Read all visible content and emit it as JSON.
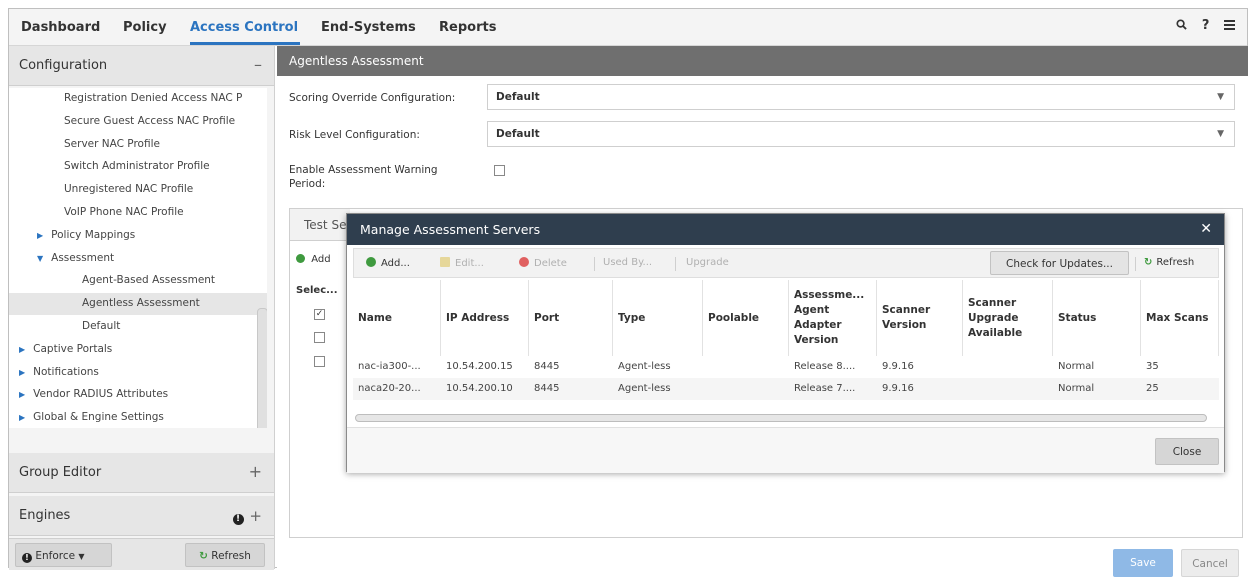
{
  "nav": {
    "items": [
      "Dashboard",
      "Policy",
      "Access Control",
      "End-Systems",
      "Reports"
    ],
    "active": "Access Control",
    "icons": [
      "search-icon",
      "help-icon",
      "menu-icon"
    ],
    "help_glyph": "?"
  },
  "sidebar": {
    "configuration_title": "Configuration",
    "tree": [
      {
        "label": "Registration Denied Access NAC P",
        "level": 2
      },
      {
        "label": "Secure Guest Access NAC Profile",
        "level": 2
      },
      {
        "label": "Server NAC Profile",
        "level": 2
      },
      {
        "label": "Switch Administrator Profile",
        "level": 2
      },
      {
        "label": "Unregistered NAC Profile",
        "level": 2
      },
      {
        "label": "VoIP Phone NAC Profile",
        "level": 2
      },
      {
        "label": "Policy Mappings",
        "level": 1,
        "arrow": "collapsed"
      },
      {
        "label": "Assessment",
        "level": 1,
        "arrow": "expanded"
      },
      {
        "label": "Agent-Based Assessment",
        "level": 3
      },
      {
        "label": "Agentless Assessment",
        "level": 3,
        "selected": true
      },
      {
        "label": "Default",
        "level": 3
      },
      {
        "label": "Captive Portals",
        "level": 0,
        "arrow": "collapsed"
      },
      {
        "label": "Notifications",
        "level": 0,
        "arrow": "collapsed"
      },
      {
        "label": "Vendor RADIUS Attributes",
        "level": 0,
        "arrow": "collapsed"
      },
      {
        "label": "Global & Engine Settings",
        "level": 0,
        "arrow": "collapsed"
      }
    ],
    "group_editor_title": "Group Editor",
    "engines_title": "Engines",
    "enforce_label": "Enforce",
    "refresh_label": "Refresh"
  },
  "main": {
    "title": "Agentless Assessment",
    "scoring_label": "Scoring Override Configuration:",
    "scoring_value": "Default",
    "risk_label": "Risk Level Configuration:",
    "risk_value": "Default",
    "warning_label_line1": "Enable Assessment Warning",
    "warning_label_line2": "Period:",
    "test_tab": "Test Se",
    "add_partial": "Add",
    "select_col": "Selec...",
    "save_label": "Save",
    "cancel_label": "Cancel"
  },
  "modal": {
    "title": "Manage Assessment Servers",
    "toolbar": {
      "add": "Add...",
      "edit": "Edit...",
      "delete": "Delete",
      "used_by": "Used By...",
      "upgrade": "Upgrade",
      "check_updates": "Check for Updates...",
      "refresh": "Refresh"
    },
    "columns": [
      "Name",
      "IP Address",
      "Port",
      "Type",
      "Poolable",
      "Assessme... Agent Adapter Version",
      "Scanner Version",
      "Scanner Upgrade Available",
      "Status",
      "Max Scans"
    ],
    "rows": [
      [
        "nac-ia300-...",
        "10.54.200.15",
        "8445",
        "Agent-less",
        "",
        "Release 8....",
        "9.9.16",
        "",
        "Normal",
        "35"
      ],
      [
        "naca20-20...",
        "10.54.200.10",
        "8445",
        "Agent-less",
        "",
        "Release 7....",
        "9.9.16",
        "",
        "Normal",
        "25"
      ]
    ],
    "close_label": "Close"
  },
  "colors": {
    "accent": "#2b74c0",
    "modal_header": "#2f3e4e",
    "main_title_bar": "#6f6f6f",
    "save_button": "#8fb9e6",
    "add_icon": "#3f9a3f",
    "delete_icon": "#e06060"
  }
}
